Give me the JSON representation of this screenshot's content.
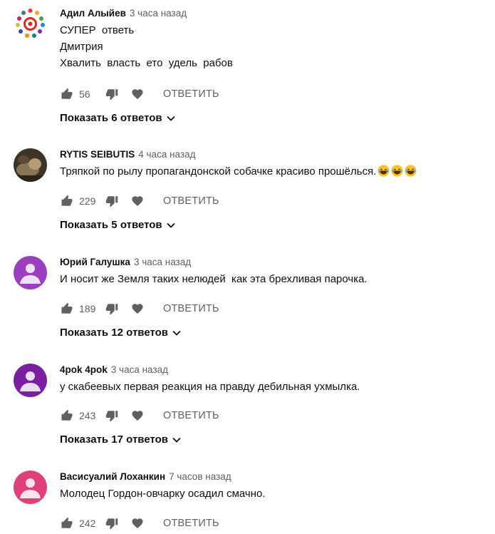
{
  "comments": [
    {
      "author": "Адил Алыйев",
      "time": "3 часа назад",
      "lines": [
        "СУПЕР  ответь",
        "Дмитрия",
        "Хвалить  власть  ето  удель  рабов"
      ],
      "likes": "56",
      "reply_label": "ОТВЕТИТЬ",
      "replies_label": "Показать 6 ответов",
      "avatar": "decorative-ring-avatar"
    },
    {
      "author": "RYTIS SEIBUTIS",
      "time": "4 часа назад",
      "lines": [
        "Тряпкой по рылу пропагандонской собачке красиво прошёлься."
      ],
      "emoji_count": 3,
      "likes": "229",
      "reply_label": "ОТВЕТИТЬ",
      "replies_label": "Показать 5 ответов",
      "avatar": "photo-avatar"
    },
    {
      "author": "Юрий Галушка",
      "time": "3 часа назад",
      "lines": [
        "И носит же Земля таких нелюдей  как эта брехливая парочка."
      ],
      "likes": "189",
      "reply_label": "ОТВЕТИТЬ",
      "replies_label": "Показать 12 ответов",
      "avatar_color": "#9c3fbf"
    },
    {
      "author": "4pok 4pok",
      "time": "3 часа назад",
      "lines": [
        "у скабеевых первая реакция на правду дебильная ухмылка."
      ],
      "likes": "243",
      "reply_label": "ОТВЕТИТЬ",
      "replies_label": "Показать 17 ответов",
      "avatar_color": "#7b1fa2"
    },
    {
      "author": "Васисуалий Лоханкин",
      "time": "7 часов назад",
      "lines": [
        "Молодец Гордон-овчарку осадил смачно."
      ],
      "likes": "242",
      "reply_label": "ОТВЕТИТЬ",
      "avatar_color": "#e0407a"
    }
  ],
  "icons": {
    "like": "thumb-up-icon",
    "dislike": "thumb-down-icon",
    "heart": "heart-icon",
    "chevron": "chevron-down-icon"
  }
}
